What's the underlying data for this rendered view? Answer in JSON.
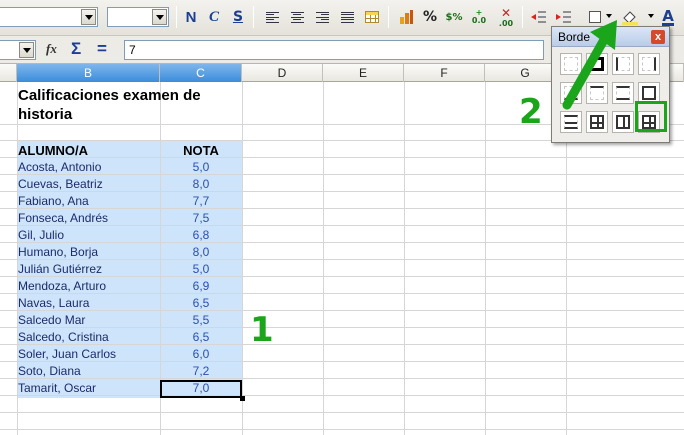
{
  "toolbar": {
    "bold_label": "N",
    "italic_label": "C",
    "underline_label": "S",
    "percent_label": "%",
    "currency_label": "$%",
    "add_decimal_label": "0.0",
    "remove_decimal_label": ".00",
    "icons": [
      "bold-icon",
      "italic-icon",
      "underline-icon",
      "align-left-icon",
      "align-center-icon",
      "align-right-icon",
      "justify-icon",
      "merge-cells-icon",
      "currency-icon",
      "percent-icon",
      "add-decimal-icon",
      "remove-decimal-icon",
      "decrease-indent-icon",
      "increase-indent-icon",
      "borders-icon",
      "background-color-icon",
      "font-color-icon"
    ]
  },
  "formula_bar": {
    "fx_label": "fx",
    "sum_label": "Σ",
    "equals_label": "=",
    "content": "7"
  },
  "columns": [
    "B",
    "C",
    "D",
    "E",
    "F",
    "G"
  ],
  "sheet": {
    "title": "Calificaciones examen de historia",
    "header_name": "ALUMNO/A",
    "header_grade": "NOTA",
    "rows": [
      {
        "name": "Acosta, Antonio",
        "grade": "5,0"
      },
      {
        "name": "Cuevas, Beatriz",
        "grade": "8,0"
      },
      {
        "name": "Fabiano, Ana",
        "grade": "7,7"
      },
      {
        "name": "Fonseca, Andrés",
        "grade": "7,5"
      },
      {
        "name": "Gil, Julio",
        "grade": "6,8"
      },
      {
        "name": "Humano, Borja",
        "grade": "8,0"
      },
      {
        "name": "Julián Gutiérrez",
        "grade": "5,0"
      },
      {
        "name": "Mendoza, Arturo",
        "grade": "6,9"
      },
      {
        "name": "Navas, Laura",
        "grade": "6,5"
      },
      {
        "name": "Salcedo Mar",
        "grade": "5,5"
      },
      {
        "name": "Salcedo, Cristina",
        "grade": "6,5"
      },
      {
        "name": "Soler, Juan Carlos",
        "grade": "6,0"
      },
      {
        "name": "Soto, Diana",
        "grade": "7,2"
      },
      {
        "name": "Tamarit, Oscar",
        "grade": "7,0"
      }
    ]
  },
  "borders_popup": {
    "title": "Borde",
    "close_label": "x"
  },
  "annotations": {
    "step1": "1",
    "step2": "2"
  },
  "colors": {
    "selection": "#cde4fa",
    "highlight_green": "#1aa51a"
  }
}
